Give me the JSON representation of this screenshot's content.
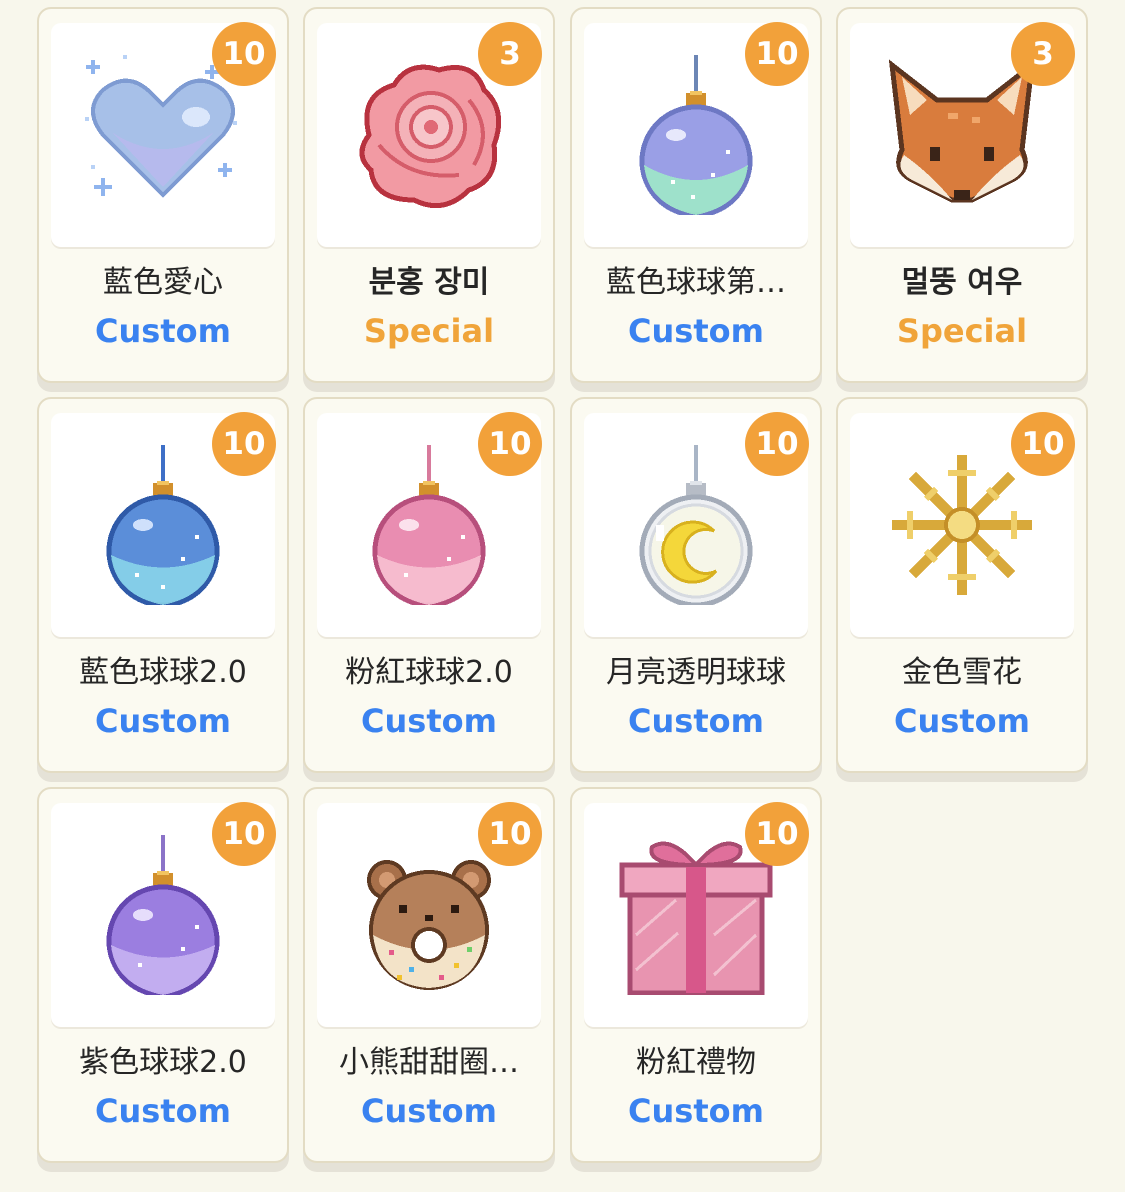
{
  "colors": {
    "background": "#f8f7ec",
    "badge": "#f2a13a",
    "custom": "#3a82f0",
    "special": "#f0a43a",
    "card_border": "#e3dcc4"
  },
  "items": [
    {
      "name": "藍色愛心",
      "bold": false,
      "count": "10",
      "tag": "Custom",
      "tag_type": "custom",
      "icon": "blue-heart-icon"
    },
    {
      "name": "분홍 장미",
      "bold": true,
      "count": "3",
      "tag": "Special",
      "tag_type": "special",
      "icon": "pink-rose-icon"
    },
    {
      "name": "藍色球球第…",
      "bold": false,
      "count": "10",
      "tag": "Custom",
      "tag_type": "custom",
      "icon": "blue-bauble-icon"
    },
    {
      "name": "멀뚱 여우",
      "bold": true,
      "count": "3",
      "tag": "Special",
      "tag_type": "special",
      "icon": "fox-icon"
    },
    {
      "name": "藍色球球2.0",
      "bold": false,
      "count": "10",
      "tag": "Custom",
      "tag_type": "custom",
      "icon": "blue-ornament-icon"
    },
    {
      "name": "粉紅球球2.0",
      "bold": false,
      "count": "10",
      "tag": "Custom",
      "tag_type": "custom",
      "icon": "pink-ornament-icon"
    },
    {
      "name": "月亮透明球球",
      "bold": false,
      "count": "10",
      "tag": "Custom",
      "tag_type": "custom",
      "icon": "moon-clear-ornament-icon"
    },
    {
      "name": "金色雪花",
      "bold": false,
      "count": "10",
      "tag": "Custom",
      "tag_type": "custom",
      "icon": "gold-snowflake-icon"
    },
    {
      "name": "紫色球球2.0",
      "bold": false,
      "count": "10",
      "tag": "Custom",
      "tag_type": "custom",
      "icon": "purple-ornament-icon"
    },
    {
      "name": "小熊甜甜圈…",
      "bold": false,
      "count": "10",
      "tag": "Custom",
      "tag_type": "custom",
      "icon": "bear-donut-icon"
    },
    {
      "name": "粉紅禮物",
      "bold": false,
      "count": "10",
      "tag": "Custom",
      "tag_type": "custom",
      "icon": "pink-gift-icon"
    }
  ]
}
